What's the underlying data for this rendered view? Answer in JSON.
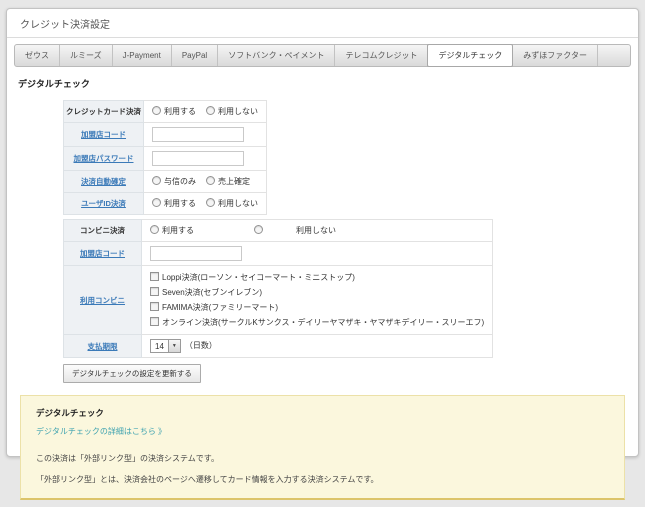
{
  "page_title": "クレジット決済設定",
  "tabs": [
    {
      "label": "ゼウス"
    },
    {
      "label": "ルミーズ"
    },
    {
      "label": "J-Payment"
    },
    {
      "label": "PayPal"
    },
    {
      "label": "ソフトバンク・ペイメント"
    },
    {
      "label": "テレコムクレジット"
    },
    {
      "label": "デジタルチェック"
    },
    {
      "label": "みずほファクター"
    }
  ],
  "active_tab": "デジタルチェック",
  "section_heading": "デジタルチェック",
  "credit_settings": {
    "card_payment": {
      "label": "クレジットカード決済",
      "options": [
        "利用する",
        "利用しない"
      ],
      "selected": ""
    },
    "merchant_code": {
      "label": "加盟店コード",
      "value": "",
      "placeholder": ""
    },
    "merchant_password": {
      "label": "加盟店パスワード",
      "value": "",
      "placeholder": ""
    },
    "auto_capture": {
      "label": "決済自動確定",
      "options": [
        "与信のみ",
        "売上確定"
      ],
      "selected": ""
    },
    "user_id_payment": {
      "label": "ユーザID決済",
      "options": [
        "利用する",
        "利用しない"
      ],
      "selected": ""
    }
  },
  "konbini_settings": {
    "konbini_payment": {
      "label": "コンビニ決済",
      "options": [
        "利用する",
        "利用しない"
      ],
      "selected": ""
    },
    "merchant_code": {
      "label": "加盟店コード",
      "value": "",
      "placeholder": ""
    },
    "stores": {
      "label": "利用コンビニ",
      "options": [
        "Loppi決済(ローソン・セイコーマート・ミニストップ)",
        "Seven決済(セブンイレブン)",
        "FAMIMA決済(ファミリーマート)",
        "オンライン決済(サークルKサンクス・デイリーヤマザキ・ヤマザキデイリー・スリーエフ)"
      ],
      "checked": [
        false,
        false,
        false,
        false
      ]
    },
    "payment_deadline": {
      "label": "支払期限",
      "value": "14",
      "suffix": "（日数）"
    }
  },
  "update_button_label": "デジタルチェックの設定を更新する",
  "info_box": {
    "title": "デジタルチェック",
    "link": "デジタルチェックの詳細はこちら 》",
    "lines": [
      "この決済は「外部リンク型」の決済システムです。",
      "「外部リンク型」とは、決済会社のページへ遷移してカード情報を入力する決済システムです。"
    ]
  },
  "colors": {
    "page_background": "#e7e7e7",
    "panel_border": "#c3c3c3",
    "label_cell_background": "#eef1f4",
    "link_blue": "#3b7ab8",
    "info_box_background": "#fbf7dd",
    "info_box_border": "#ece1a8",
    "info_link_teal": "#3fa3b0"
  }
}
